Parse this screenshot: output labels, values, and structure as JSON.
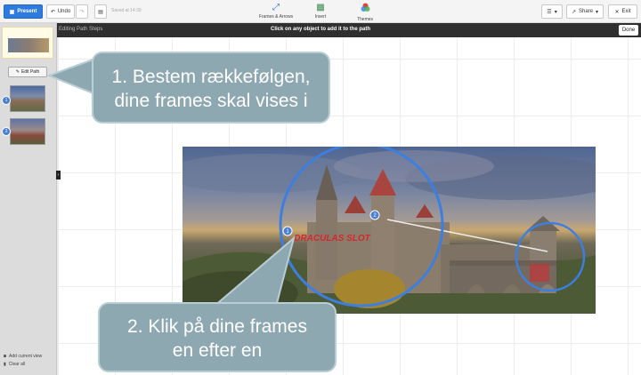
{
  "toolbar": {
    "present_label": "Present",
    "undo_label": "Undo",
    "saved_text": "Saved at 14:39",
    "tools": [
      {
        "label": "Frames & Arrows",
        "icon": "frames-arrows-icon"
      },
      {
        "label": "Insert",
        "icon": "insert-image-icon"
      },
      {
        "label": "Themes",
        "icon": "themes-icon"
      }
    ],
    "share_label": "Share",
    "exit_label": "Exit"
  },
  "editbar": {
    "mode_label": "Editing Path Steps",
    "instruction": "Click on any object to add it to the path",
    "done_label": "Done"
  },
  "sidebar": {
    "edit_path_label": "Edit Path",
    "steps": [
      {
        "number": "1"
      },
      {
        "number": "2"
      }
    ],
    "add_current_view_label": "Add current view",
    "clear_all_label": "Clear all"
  },
  "canvas": {
    "title_text": "DRACULAS SLOT",
    "frame_numbers": [
      "1",
      "2"
    ]
  },
  "callouts": {
    "first_line1": "1. Bestem rækkefølgen,",
    "first_line2": "dine frames skal vises i",
    "second_line1": "2. Klik på dine frames",
    "second_line2": "en efter en"
  },
  "colors": {
    "accent": "#2e7be0",
    "editbar": "#2f2f2f",
    "callout": "#8ea8b1",
    "path_circle": "#3d7fe0",
    "title_red": "#d9262b"
  }
}
